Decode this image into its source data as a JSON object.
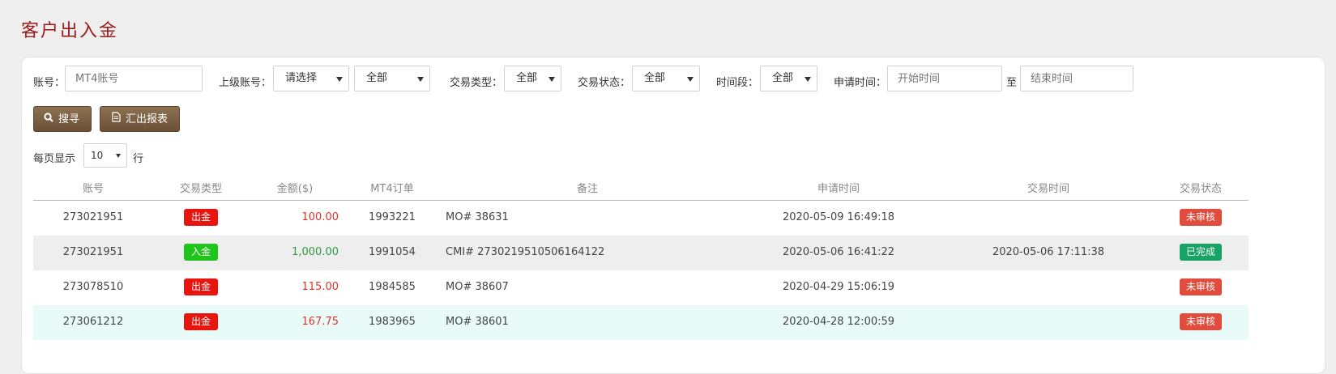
{
  "page": {
    "title": "客户出入金"
  },
  "filters": {
    "account_label": "账号：",
    "account_placeholder": "MT4账号",
    "parent_label": "上级账号：",
    "parent_select": "请选择",
    "parent_scope": "全部",
    "type_label": "交易类型：",
    "type_value": "全部",
    "status_label": "交易状态：",
    "status_value": "全部",
    "period_label": "时间段：",
    "period_value": "全部",
    "apply_label": "申请时间：",
    "start_placeholder": "开始时间",
    "to_label": "至",
    "end_placeholder": "结束时间"
  },
  "actions": {
    "search": "搜寻",
    "export": "汇出报表"
  },
  "pagination": {
    "per_page_label": "每页显示",
    "per_page_value": "10",
    "rows_label": "行"
  },
  "table": {
    "headers": {
      "account": "账号",
      "type": "交易类型",
      "amount": "金额($)",
      "order": "MT4订单",
      "note": "备注",
      "apply_time": "申请时间",
      "trade_time": "交易时间",
      "status": "交易状态"
    },
    "rows": [
      {
        "account": "273021951",
        "type": "出金",
        "amount": "100.00",
        "order": "1993221",
        "note": "MO# 38631",
        "apply_time": "2020-05-09 16:49:18",
        "trade_time": "",
        "status": "未审核"
      },
      {
        "account": "273021951",
        "type": "入金",
        "amount": "1,000.00",
        "order": "1991054",
        "note": "CMI# 2730219510506164122",
        "apply_time": "2020-05-06 16:41:22",
        "trade_time": "2020-05-06 17:11:38",
        "status": "已完成"
      },
      {
        "account": "273078510",
        "type": "出金",
        "amount": "115.00",
        "order": "1984585",
        "note": "MO# 38607",
        "apply_time": "2020-04-29 15:06:19",
        "trade_time": "",
        "status": "未审核"
      },
      {
        "account": "273061212",
        "type": "出金",
        "amount": "167.75",
        "order": "1983965",
        "note": "MO# 38601",
        "apply_time": "2020-04-28 12:00:59",
        "trade_time": "",
        "status": "未审核"
      }
    ]
  },
  "colors": {
    "title": "#9b1a1a",
    "withdraw_badge": "#e8150e",
    "deposit_badge": "#1fc51b",
    "pending_badge": "#e14c3c",
    "done_badge": "#17a363",
    "withdraw_amount": "#d9342b",
    "deposit_amount": "#2c9a3e",
    "row_alt": "#eeeeee",
    "row_highlight": "#e8fbf8"
  }
}
